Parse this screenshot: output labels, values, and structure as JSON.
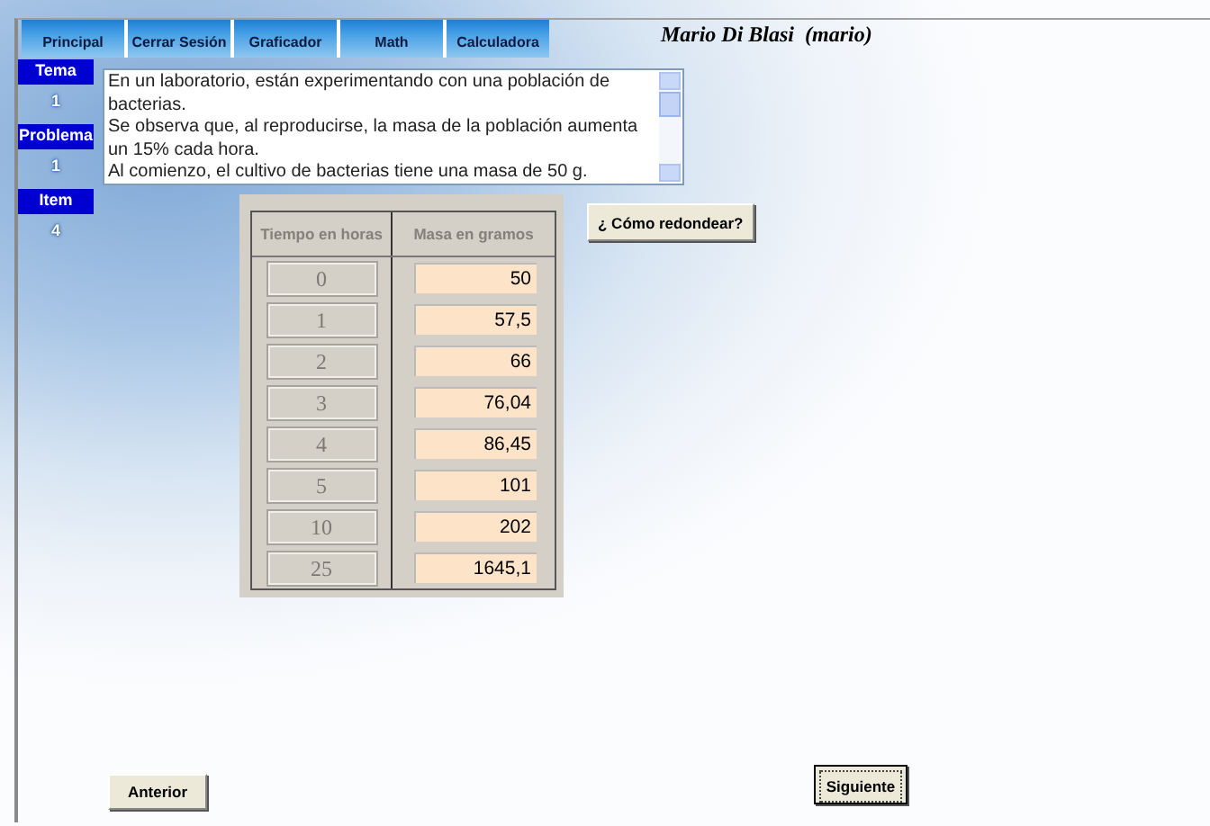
{
  "nav": [
    {
      "label": "Principal"
    },
    {
      "label": "Cerrar Sesión"
    },
    {
      "label": "Graficador"
    },
    {
      "label": "Math"
    },
    {
      "label": "Calculadora"
    }
  ],
  "user": "Mario Di Blasi  (mario)",
  "sidebar": [
    {
      "label": "Tema",
      "value": "1"
    },
    {
      "label": "Problema",
      "value": "1"
    },
    {
      "label": "Item",
      "value": "4"
    }
  ],
  "problem_text": "En un laboratorio, están experimentando con una población de bacterias.\nSe observa que, al reproducirse, la masa de la población aumenta un 15% cada hora.\nAl comienzo, el cultivo de bacterias tiene una masa de 50 g.",
  "table": {
    "columns": [
      "Tiempo en horas",
      "Masa en gramos"
    ],
    "rows": [
      {
        "time": "0",
        "mass": "50"
      },
      {
        "time": "1",
        "mass": "57,5"
      },
      {
        "time": "2",
        "mass": "66"
      },
      {
        "time": "3",
        "mass": "76,04"
      },
      {
        "time": "4",
        "mass": "86,45"
      },
      {
        "time": "5",
        "mass": "101"
      },
      {
        "time": "10",
        "mass": "202"
      },
      {
        "time": "25",
        "mass": "1645,1"
      }
    ]
  },
  "round_button": "¿ Cómo redondear?",
  "footer": {
    "previous": "Anterior",
    "next": "Siguiente"
  }
}
